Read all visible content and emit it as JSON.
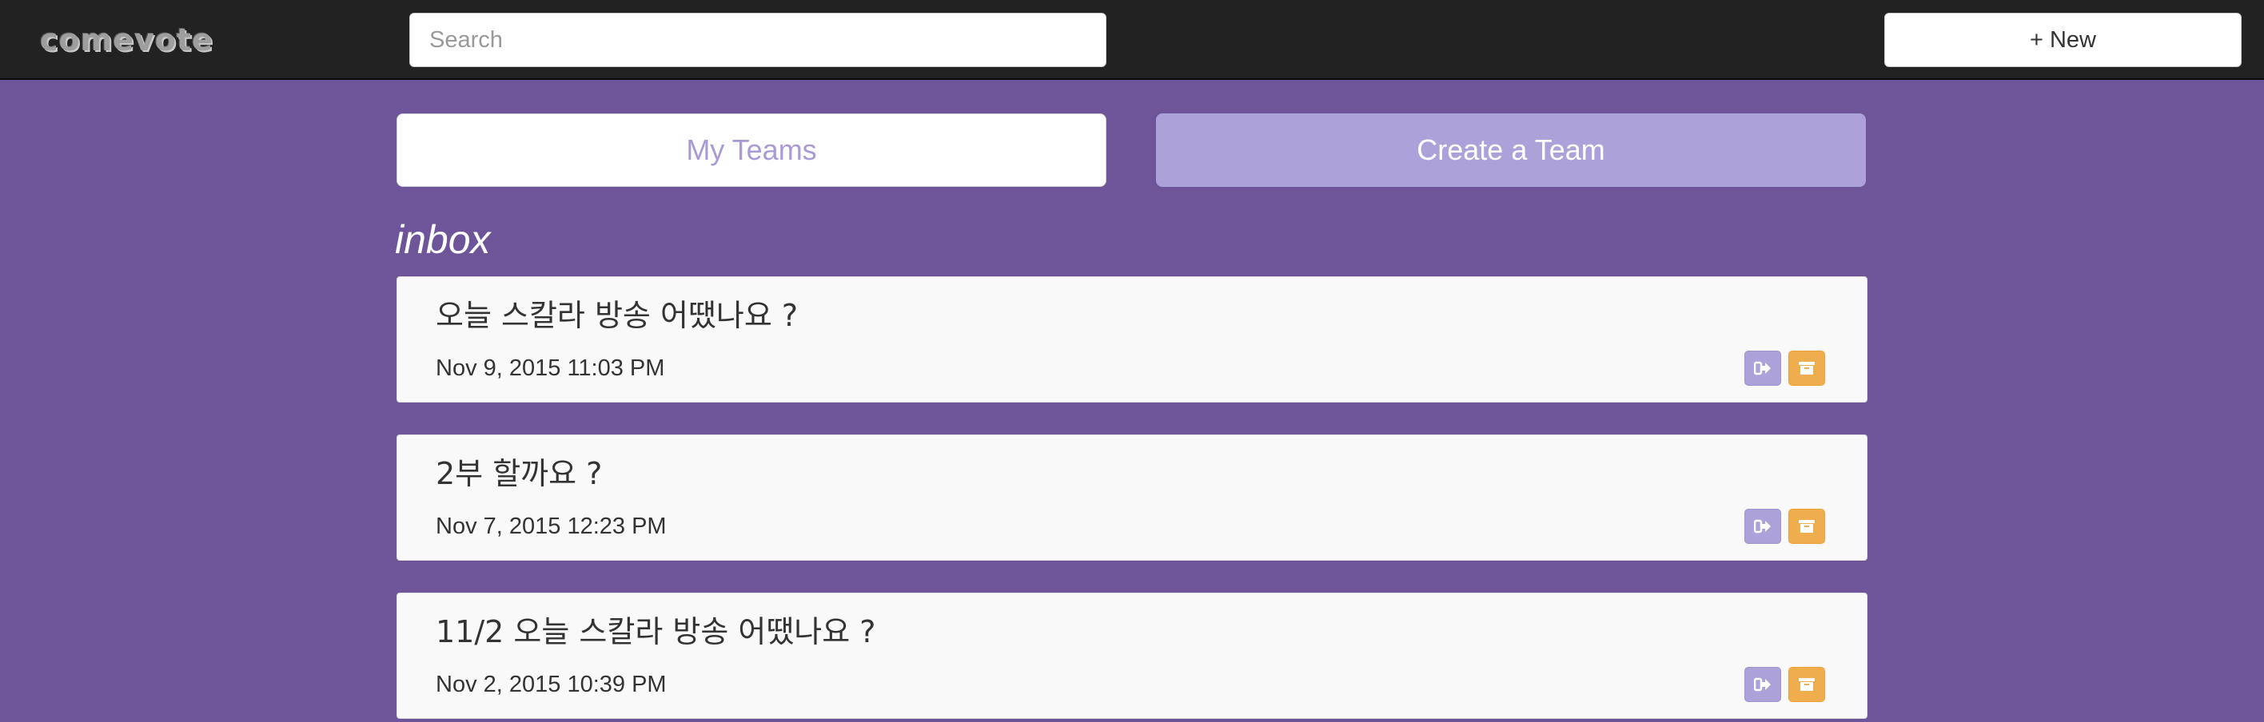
{
  "navbar": {
    "logo_text": "comevote",
    "search_placeholder": "Search",
    "new_button_label": "+ New"
  },
  "tabs": {
    "my_teams_label": "My Teams",
    "create_team_label": "Create a Team"
  },
  "inbox": {
    "title": "inbox",
    "items": [
      {
        "title": "오늘 스칼라 방송 어땠나요 ?",
        "date": "Nov 9, 2015 11:03 PM",
        "actions": [
          "leave-icon",
          "archive-icon"
        ]
      },
      {
        "title": "2부 할까요 ?",
        "date": "Nov 7, 2015 12:23 PM",
        "actions": [
          "leave-icon",
          "archive-icon"
        ]
      },
      {
        "title": "11/2 오늘 스칼라 방송 어땠나요 ?",
        "date": "Nov 2, 2015 10:39 PM",
        "actions": [
          "leave-icon",
          "archive-icon"
        ]
      }
    ]
  },
  "colors": {
    "background": "#6e5499",
    "navbar": "#222222",
    "accent_purple": "#aca2d9",
    "accent_orange": "#f0ad4e"
  }
}
